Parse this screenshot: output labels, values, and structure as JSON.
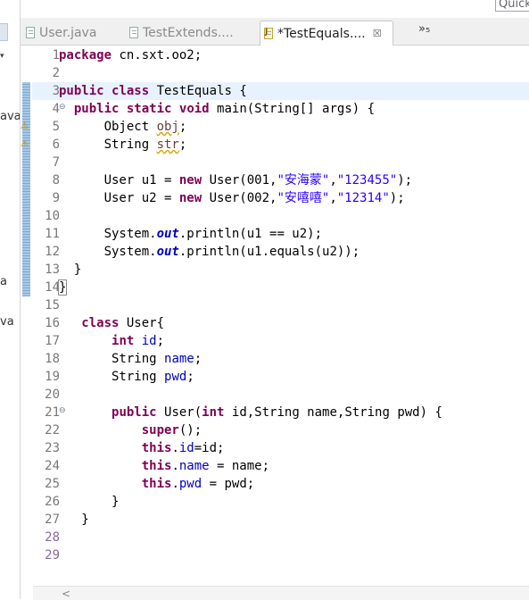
{
  "quick_access": {
    "placeholder": "Quick Access"
  },
  "left_pane": {
    "fragments": [
      "ava",
      "a",
      "va"
    ]
  },
  "tabs": [
    {
      "label": "User.java",
      "active": false
    },
    {
      "label": "TestExtends....",
      "active": false
    },
    {
      "label": "*TestEquals....",
      "active": true
    }
  ],
  "tab_overflow": "»₅",
  "editor": {
    "line_numbers": [
      "1",
      "2",
      "3",
      "4",
      "5",
      "6",
      "7",
      "8",
      "9",
      "10",
      "11",
      "12",
      "13",
      "14",
      "15",
      "16",
      "17",
      "18",
      "19",
      "20",
      "21",
      "22",
      "23",
      "24",
      "25",
      "26",
      "27",
      "28",
      "29"
    ],
    "lines": [
      "package cn.sxt.oo2;",
      "",
      "public class TestEquals {",
      "  public static void main(String[] args) {",
      "      Object obj;",
      "      String str;",
      "",
      "      User u1 = new User(001,\"安海蒙\",\"123455\");",
      "      User u2 = new User(002,\"安嘻嘻\",\"12314\");",
      "",
      "      System.out.println(u1 == u2);",
      "      System.out.println(u1.equals(u2));",
      "  }",
      "}",
      "",
      "   class User{",
      "       int id;",
      "       String name;",
      "       String pwd;",
      "",
      "       public User(int id,String name,String pwd) {",
      "           super();",
      "           this.id=id;",
      "           this.name = name;",
      "           this.pwd = pwd;",
      "       }",
      "   }",
      "",
      ""
    ]
  },
  "colors": {
    "keyword": "#7f0055",
    "string": "#2a00ff",
    "field": "#0000c0",
    "current_line": "#e8f2fe"
  }
}
